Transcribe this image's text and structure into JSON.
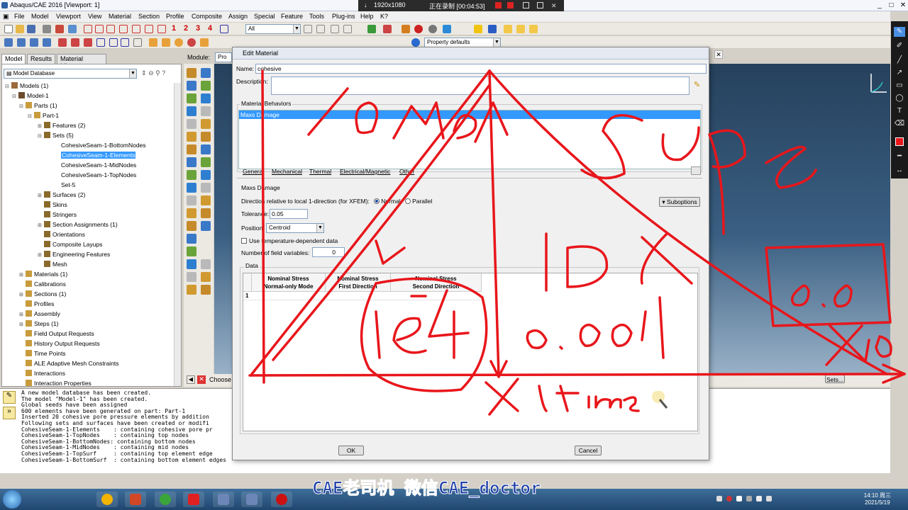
{
  "window": {
    "title": "Abaqus/CAE 2016 [Viewport: 1]",
    "controls": [
      "_",
      "□",
      "✕"
    ]
  },
  "recorder": {
    "resolution": "1920x1080",
    "status": "正在录制 [00:04:53]"
  },
  "menu": {
    "items": [
      "File",
      "Model",
      "Viewport",
      "View",
      "Material",
      "Section",
      "Profile",
      "Composite",
      "Assign",
      "Special",
      "Feature",
      "Tools",
      "Plug-ins",
      "Help",
      "K?"
    ]
  },
  "toolbar": {
    "numbers": [
      "1",
      "2",
      "3",
      "4"
    ],
    "filter_combo": "All",
    "property_combo": "Property defaults"
  },
  "left_panel": {
    "tabs": [
      "Model",
      "Results",
      "Material Library"
    ],
    "database_combo": "Model Database",
    "tree": [
      {
        "label": "Models (1)",
        "level": 0,
        "exp": "⊟"
      },
      {
        "label": "Model-1",
        "level": 1,
        "exp": "⊟"
      },
      {
        "label": "Parts (1)",
        "level": 2,
        "exp": "⊟"
      },
      {
        "label": "Part-1",
        "level": 3,
        "exp": "⊟"
      },
      {
        "label": "Features (2)",
        "level": 4,
        "exp": "⊞"
      },
      {
        "label": "Sets (5)",
        "level": 4,
        "exp": "⊟"
      },
      {
        "label": "CohesiveSeam-1-BottomNodes",
        "level": 5,
        "exp": ""
      },
      {
        "label": "CohesiveSeam-1-Elements",
        "level": 5,
        "exp": "",
        "selected": true
      },
      {
        "label": "CohesiveSeam-1-MidNodes",
        "level": 5,
        "exp": ""
      },
      {
        "label": "CohesiveSeam-1-TopNodes",
        "level": 5,
        "exp": ""
      },
      {
        "label": "Set-5",
        "level": 5,
        "exp": ""
      },
      {
        "label": "Surfaces (2)",
        "level": 4,
        "exp": "⊞"
      },
      {
        "label": "Skins",
        "level": 4,
        "exp": ""
      },
      {
        "label": "Stringers",
        "level": 4,
        "exp": ""
      },
      {
        "label": "Section Assignments (1)",
        "level": 4,
        "exp": "⊞"
      },
      {
        "label": "Orientations",
        "level": 4,
        "exp": ""
      },
      {
        "label": "Composite Layups",
        "level": 4,
        "exp": ""
      },
      {
        "label": "Engineering Features",
        "level": 4,
        "exp": "⊞"
      },
      {
        "label": "Mesh",
        "level": 4,
        "exp": ""
      },
      {
        "label": "Materials (1)",
        "level": 2,
        "exp": "⊞"
      },
      {
        "label": "Calibrations",
        "level": 2,
        "exp": ""
      },
      {
        "label": "Sections (1)",
        "level": 2,
        "exp": "⊞"
      },
      {
        "label": "Profiles",
        "level": 2,
        "exp": ""
      },
      {
        "label": "Assembly",
        "level": 2,
        "exp": "⊞"
      },
      {
        "label": "Steps (1)",
        "level": 2,
        "exp": "⊞"
      },
      {
        "label": "Field Output Requests",
        "level": 2,
        "exp": ""
      },
      {
        "label": "History Output Requests",
        "level": 2,
        "exp": ""
      },
      {
        "label": "Time Points",
        "level": 2,
        "exp": ""
      },
      {
        "label": "ALE Adaptive Mesh Constraints",
        "level": 2,
        "exp": ""
      },
      {
        "label": "Interactions",
        "level": 2,
        "exp": ""
      },
      {
        "label": "Interaction Properties",
        "level": 2,
        "exp": ""
      }
    ]
  },
  "module_label": "Module:",
  "module_combo": "Pro",
  "prompt": {
    "text": "Choose",
    "sets_button": "Sets..."
  },
  "messages": [
    "A new model database has been created.",
    "The model \"Model-1\" has been created.",
    "Global seeds have been assigned",
    "600 elements have been generated on part: Part-1",
    "Inserted 20 cohesive pore pressure elements by addition",
    "Following sets and surfaces have been created or modifi",
    "CohesiveSeam-1-Elements    : containing cohesive pore pr",
    "CohesiveSeam-1-TopNodes    : containing top nodes",
    "CohesiveSeam-1-BottomNodes: containing bottom nodes",
    "CohesiveSeam-1-MidNodes    : containing mid nodes",
    "CohesiveSeam-1-TopSurf     : containing top element edge",
    "CohesiveSeam-1-BottomSurf  : containing bottom element edges"
  ],
  "dialog": {
    "title": "Edit Material",
    "name_label": "Name:",
    "name_value": "cohesive",
    "description_label": "Description:",
    "behaviors_title": "Material Behaviors",
    "behaviors": [
      "Maxs Damage"
    ],
    "menus": [
      "General",
      "Mechanical",
      "Thermal",
      "Electrical/Magnetic",
      "Other"
    ],
    "section_title": "Maxs Damage",
    "direction_label": "Direction relative to local 1-direction (for XFEM):",
    "direction_options": [
      "Normal",
      "Parallel"
    ],
    "suboptions_button": "Suboptions",
    "tolerance_label": "Tolerance:",
    "tolerance_value": "0.05",
    "position_label": "Position:",
    "position_value": "Centroid",
    "temp_dependent_label": "Use temperature-dependent data",
    "field_vars_label": "Number of field variables:",
    "field_vars_value": "0",
    "data_title": "Data",
    "table_headers": [
      "Nominal Stress\nNormal-only Mode",
      "Nominal Stress\nFirst Direction",
      "Nominal Stress\nSecond Direction"
    ],
    "row_numbers": [
      "1"
    ],
    "ok_button": "OK",
    "cancel_button": "Cancel"
  },
  "annotations": {
    "handwriting": [
      "10MPa",
      "SuPe",
      "1D",
      "0.0",
      "X10",
      "1e-4",
      "0.001",
      "X time"
    ],
    "stroke_color": "#e8161b"
  },
  "taskbar": {
    "time": "14:10 周三",
    "date": "2021/5/19"
  },
  "caption": "CAE老司机 微信CAE_doctor"
}
